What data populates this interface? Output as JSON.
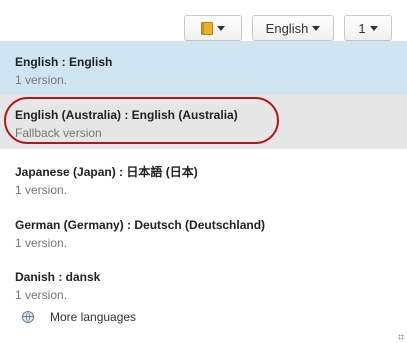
{
  "toolbar": {
    "icon_button": "book-icon",
    "language_label": "English",
    "count_label": "1"
  },
  "languages": [
    {
      "title": "English : English",
      "subtitle": "1 version."
    },
    {
      "title": "English (Australia) : English (Australia)",
      "subtitle": "Fallback version"
    },
    {
      "title": "Japanese (Japan) : 日本語 (日本)",
      "subtitle": "1 version."
    },
    {
      "title": "German (Germany) : Deutsch (Deutschland)",
      "subtitle": "1 version."
    },
    {
      "title": "Danish : dansk",
      "subtitle": "1 version."
    }
  ],
  "more_languages": {
    "icon": "globe-icon",
    "label": "More languages"
  },
  "colors": {
    "selected_row": "#cfe6f2",
    "hover_row": "#e6e6e6",
    "annotation_ring": "#b01820"
  }
}
